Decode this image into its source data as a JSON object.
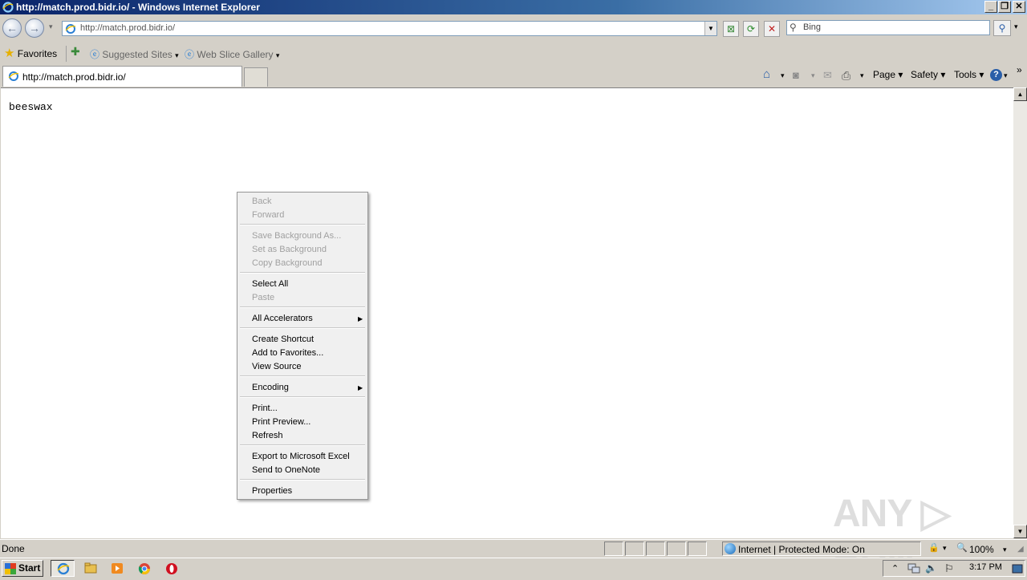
{
  "window": {
    "title": "http://match.prod.bidr.io/ - Windows Internet Explorer",
    "minimize_glyph": "_",
    "restore_glyph": "❐",
    "close_glyph": "✕"
  },
  "address_bar": {
    "back_glyph": "←",
    "forward_glyph": "→",
    "history_glyph": "▾",
    "url": "http://match.prod.bidr.io/",
    "dropdown_glyph": "▼",
    "compat_glyph": "⊠",
    "refresh_glyph": "⟳",
    "stop_glyph": "✕",
    "search_placeholder": "Bing",
    "search_icon": "⚲",
    "search_go_glyph": "⚲",
    "search_menu_glyph": "▾"
  },
  "favorites_bar": {
    "favorites_label": "Favorites",
    "star_glyph": "★",
    "add_glyph": "✚",
    "items": [
      {
        "label": "Suggested Sites",
        "arrow": "▾"
      },
      {
        "label": "Web Slice Gallery",
        "arrow": "▾"
      }
    ]
  },
  "tabs": [
    {
      "label": "http://match.prod.bidr.io/"
    }
  ],
  "command_bar": {
    "home_glyph": "⌂",
    "home_arrow": "▾",
    "feeds_glyph": "◙",
    "feeds_arrow": "▾",
    "mail_glyph": "✉",
    "print_glyph": "⎙",
    "print_arrow": "▾",
    "page_label": "Page ▾",
    "safety_label": "Safety ▾",
    "tools_label": "Tools ▾",
    "help_glyph": "?",
    "help_arrow": "▾",
    "more_glyph": "»"
  },
  "page": {
    "body_text": "beeswax"
  },
  "scrollbar": {
    "up_glyph": "▲",
    "down_glyph": "▼"
  },
  "context_menu": {
    "submenu_arrow": "▶",
    "groups": [
      [
        {
          "label": "Back",
          "enabled": false
        },
        {
          "label": "Forward",
          "enabled": false
        }
      ],
      [
        {
          "label": "Save Background As...",
          "enabled": false
        },
        {
          "label": "Set as Background",
          "enabled": false
        },
        {
          "label": "Copy Background",
          "enabled": false
        }
      ],
      [
        {
          "label": "Select All",
          "enabled": true
        },
        {
          "label": "Paste",
          "enabled": false
        }
      ],
      [
        {
          "label": "All Accelerators",
          "enabled": true,
          "submenu": true
        }
      ],
      [
        {
          "label": "Create Shortcut",
          "enabled": true
        },
        {
          "label": "Add to Favorites...",
          "enabled": true
        },
        {
          "label": "View Source",
          "enabled": true
        }
      ],
      [
        {
          "label": "Encoding",
          "enabled": true,
          "submenu": true
        }
      ],
      [
        {
          "label": "Print...",
          "enabled": true
        },
        {
          "label": "Print Preview...",
          "enabled": true
        },
        {
          "label": "Refresh",
          "enabled": true
        }
      ],
      [
        {
          "label": "Export to Microsoft Excel",
          "enabled": true
        },
        {
          "label": "Send to OneNote",
          "enabled": true
        }
      ],
      [
        {
          "label": "Properties",
          "enabled": true
        }
      ]
    ]
  },
  "status_bar": {
    "status_text": "Done",
    "zone_text": "Internet | Protected Mode: On",
    "security_glyph": "🔒",
    "security_arrow": "▾",
    "zoom_text": "100%",
    "zoom_glyph": "🔍",
    "zoom_arrow": "▾",
    "resize_glyph": "◢"
  },
  "taskbar": {
    "start_label": "Start",
    "tray_up_glyph": "⌃",
    "volume_glyph": "🔈",
    "flag_glyph": "⚐",
    "clock": "3:17 PM"
  },
  "watermark": "ANY ▷ RUN",
  "colors": {
    "accent": "#0a246a",
    "menu_disabled": "#a0a0a0"
  }
}
